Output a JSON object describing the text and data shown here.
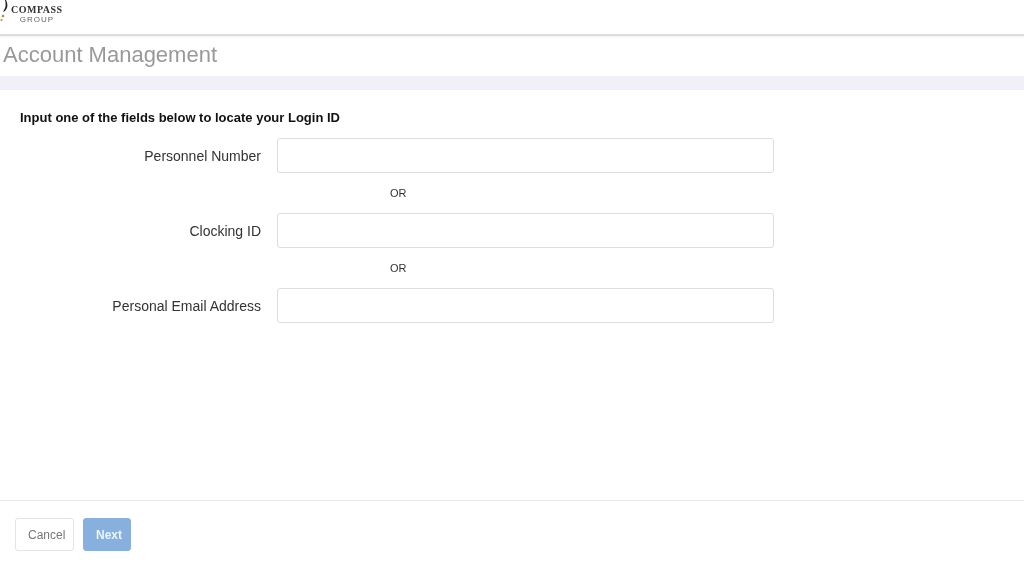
{
  "logo": {
    "name": "COMPASS",
    "subtitle": "GROUP"
  },
  "page_title": "Account Management",
  "instructions": "Input one of the fields below to locate your Login ID",
  "fields": [
    {
      "kind": "field",
      "label": "Personnel Number"
    },
    {
      "kind": "separator",
      "label": "OR"
    },
    {
      "kind": "field",
      "label": "Clocking ID"
    },
    {
      "kind": "separator",
      "label": "OR"
    },
    {
      "kind": "field",
      "label": "Personal Email Address"
    }
  ],
  "buttons": [
    {
      "label": "Cancel",
      "kind": "secondary",
      "disabled": false
    },
    {
      "label": "Next",
      "kind": "primary",
      "disabled": true
    }
  ]
}
